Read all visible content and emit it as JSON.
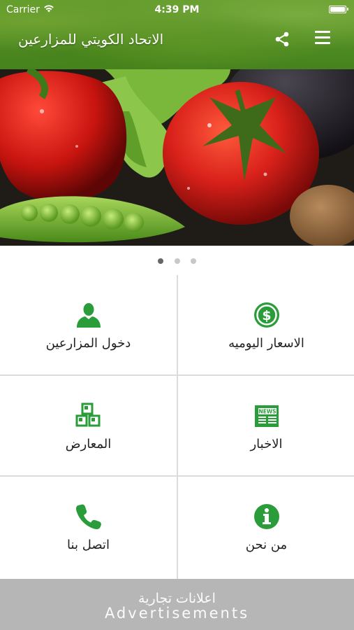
{
  "status_bar": {
    "carrier": "Carrier",
    "time": "4:39 PM",
    "icons": [
      "wifi-icon",
      "battery-icon"
    ]
  },
  "header": {
    "title": "الاتحاد الكويتي للمزارعين",
    "share_icon": "share-icon",
    "menu_icon": "hamburger-menu-icon"
  },
  "banner": {
    "slide_count": 3,
    "active_slide": 1
  },
  "grid": {
    "accent_color": "#2a9d3a",
    "items": [
      {
        "label": "الاسعار اليوميه",
        "icon": "dollar-circle-icon"
      },
      {
        "label": "دخول المزارعين",
        "icon": "user-icon"
      },
      {
        "label": "الاخبار",
        "icon": "newspaper-icon"
      },
      {
        "label": "المعارض",
        "icon": "cubes-icon"
      },
      {
        "label": "من نحن",
        "icon": "info-circle-icon"
      },
      {
        "label": "اتصل بنا",
        "icon": "phone-icon"
      }
    ]
  },
  "ad": {
    "arabic": "اعلانات تجارية",
    "english": "Advertisements"
  }
}
